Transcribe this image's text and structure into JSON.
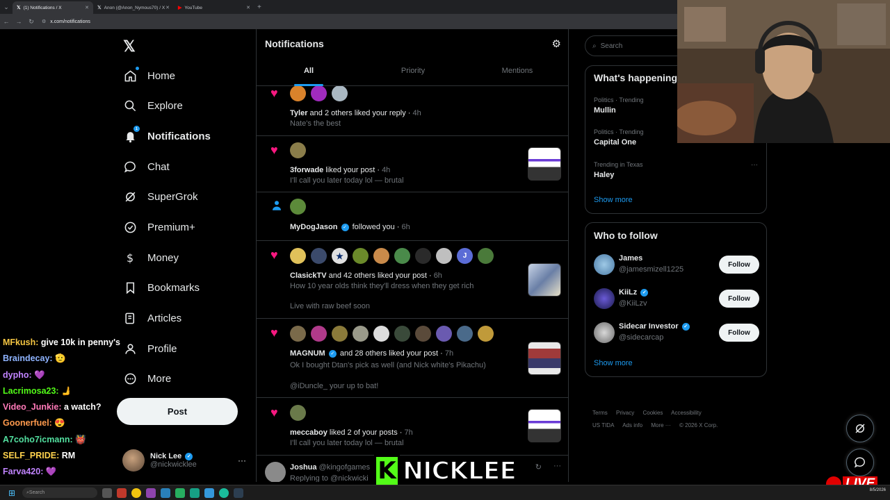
{
  "browser": {
    "tabs": [
      {
        "label": "(1) Notifications / X",
        "favicon": "x-icon"
      },
      {
        "label": "Anon (@Anon_Nymous70) / X",
        "favicon": "x-icon"
      },
      {
        "label": "YouTube",
        "favicon": "youtube-icon"
      }
    ],
    "url": "x.com/notifications"
  },
  "sidebar": {
    "items": [
      {
        "label": "Home",
        "icon": "home-icon"
      },
      {
        "label": "Explore",
        "icon": "search-icon"
      },
      {
        "label": "Notifications",
        "icon": "bell-icon",
        "badge": "1"
      },
      {
        "label": "Chat",
        "icon": "chat-icon"
      },
      {
        "label": "SuperGrok",
        "icon": "grok-icon"
      },
      {
        "label": "Premium+",
        "icon": "premium-icon"
      },
      {
        "label": "Money",
        "icon": "money-icon"
      },
      {
        "label": "Bookmarks",
        "icon": "bookmark-icon"
      },
      {
        "label": "Articles",
        "icon": "article-icon"
      },
      {
        "label": "Profile",
        "icon": "person-icon"
      },
      {
        "label": "More",
        "icon": "more-circle-icon"
      }
    ],
    "post_label": "Post",
    "account": {
      "name": "Nick Lee",
      "handle": "@nickwicklee"
    }
  },
  "main": {
    "title": "Notifications",
    "tabs": [
      "All",
      "Priority",
      "Mentions"
    ],
    "notifications": [
      {
        "actor": "Tyler",
        "action": " and 2 others liked your reply",
        "time": "4h",
        "text": "Nate's the best"
      },
      {
        "actor": "3forwade",
        "action": " liked your post",
        "time": "4h",
        "text": "I'll call you later today lol — brutal"
      },
      {
        "actor": "MyDogJason",
        "action": " followed you",
        "time": "6h",
        "text": ""
      },
      {
        "actor": "ClasickTV",
        "action": " and 42 others liked your post",
        "time": "6h",
        "text": "How 10 year olds think they'll dress when they get rich",
        "text2": "Live with raw beef soon"
      },
      {
        "actor": "MAGNUM",
        "action": " and 28 others liked your post",
        "time": "7h",
        "text": "Ok I bought Dtan's pick as well (and Nick white's Pikachu)",
        "text2": "@iDuncle_ your up to bat!"
      },
      {
        "actor": "meccaboy",
        "action": " liked 2 of your posts",
        "time": "7h",
        "text": "I'll call you later today lol — brutal"
      },
      {
        "actor": "Joshua",
        "handle": "@kingofgames",
        "reply": "Replying to @nickwicki"
      }
    ]
  },
  "right": {
    "search_placeholder": "Search",
    "trends_title": "What's happening",
    "trends": [
      {
        "category": "Politics · Trending",
        "name": "Mullin"
      },
      {
        "category": "Politics · Trending",
        "name": "Capital One"
      },
      {
        "category": "Trending in Texas",
        "name": "Haley"
      }
    ],
    "show_more": "Show more",
    "wtf_title": "Who to follow",
    "follow_label": "Follow",
    "wtf": [
      {
        "name": "James",
        "handle": "@jamesmizell1225"
      },
      {
        "name": "KiiLz",
        "handle": "@KiiLzv"
      },
      {
        "name": "Sidecar Investor",
        "handle": "@sidecarcap"
      }
    ],
    "footer": [
      "Terms",
      "Privacy",
      "Cookies",
      "Accessibility",
      "US TIDA",
      "Ads info",
      "More ···",
      "© 2026 X Corp."
    ]
  },
  "stream_chat": [
    {
      "user": "MFkush:",
      "msg": " give 10k in penny's",
      "color": "#f4c542"
    },
    {
      "user": "Braindecay:",
      "msg": " 🫡",
      "color": "#8fb4ff"
    },
    {
      "user": "dypho:",
      "msg": " 💜",
      "color": "#c184ff"
    },
    {
      "user": "Lacrimosa23:",
      "msg": " 🫸",
      "color": "#53fc18"
    },
    {
      "user": "Video_Junkie:",
      "msg": " a watch?",
      "color": "#ff7ab8"
    },
    {
      "user": "Goonerfuel:",
      "msg": " 😍",
      "color": "#ff9a4d"
    },
    {
      "user": "A7coho7icmann:",
      "msg": " 👹",
      "color": "#53e0a0"
    },
    {
      "user": "SELF_PRIDE:",
      "msg": " RM",
      "color": "#ffd24d"
    },
    {
      "user": "Farva420:",
      "msg": " 💜",
      "color": "#c184ff"
    }
  ],
  "overlay": {
    "logo_k": "K",
    "logo_text": "NICKLEE",
    "live": "LIVE"
  },
  "taskbar": {
    "search": "Search",
    "date": "8/5/2026"
  }
}
